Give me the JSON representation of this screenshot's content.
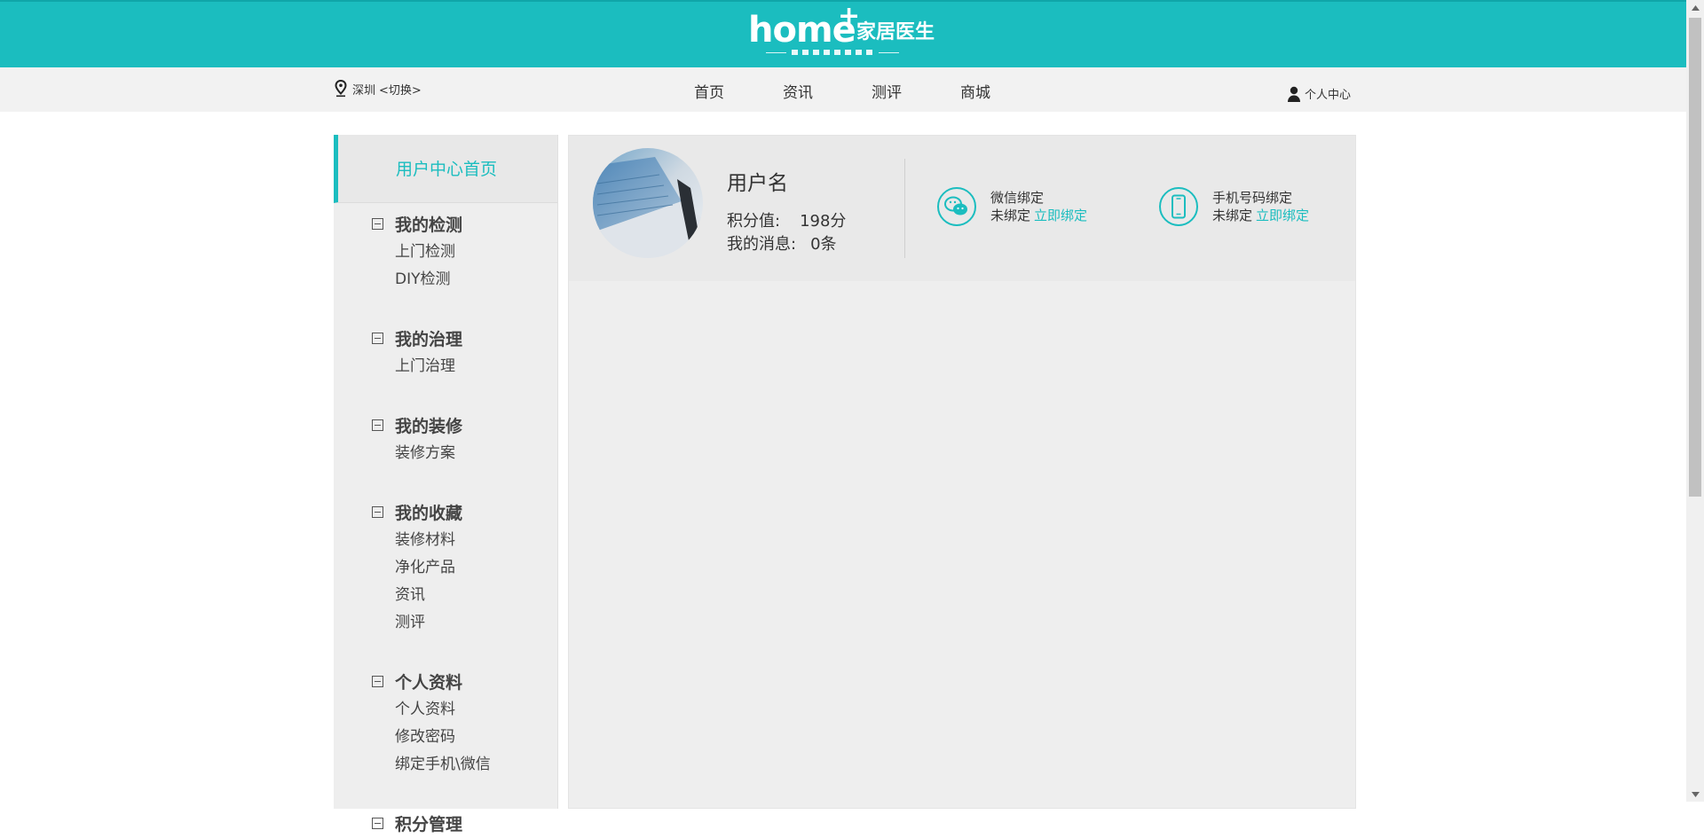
{
  "brand": {
    "logo_text": "home",
    "logo_plus": "+",
    "logo_cn": "家居医生"
  },
  "nav": {
    "city": "深圳",
    "switch_label": "<切换>",
    "links": [
      "首页",
      "资讯",
      "测评",
      "商城"
    ],
    "user_center": "个人中心"
  },
  "sidebar": {
    "home_label": "用户中心首页",
    "groups": [
      {
        "title": "我的检测",
        "items": [
          "上门检测",
          "DIY检测"
        ]
      },
      {
        "title": "我的治理",
        "items": [
          "上门治理"
        ]
      },
      {
        "title": "我的装修",
        "items": [
          "装修方案"
        ]
      },
      {
        "title": "我的收藏",
        "items": [
          "装修材料",
          "净化产品",
          "资讯",
          "测评"
        ]
      },
      {
        "title": "个人资料",
        "items": [
          "个人资料",
          "修改密码",
          "绑定手机\\微信"
        ]
      },
      {
        "title": "积分管理",
        "items": []
      }
    ]
  },
  "profile": {
    "username": "用户名",
    "points_label": "积分值:",
    "points_value": "198分",
    "messages_label": "我的消息:",
    "messages_value": "0条"
  },
  "bindings": {
    "wechat": {
      "title": "微信绑定",
      "status": "未绑定",
      "action": "立即绑定"
    },
    "phone": {
      "title": "手机号码绑定",
      "status": "未绑定",
      "action": "立即绑定"
    }
  },
  "colors": {
    "brand": "#1bbdbf",
    "nav_bg": "#f2f2f2",
    "panel_bg": "#eeeeee"
  },
  "icons": {
    "location": "location-pin-icon",
    "user": "user-icon",
    "wechat": "wechat-icon",
    "phone": "phone-icon",
    "collapse": "minus-box-icon"
  }
}
